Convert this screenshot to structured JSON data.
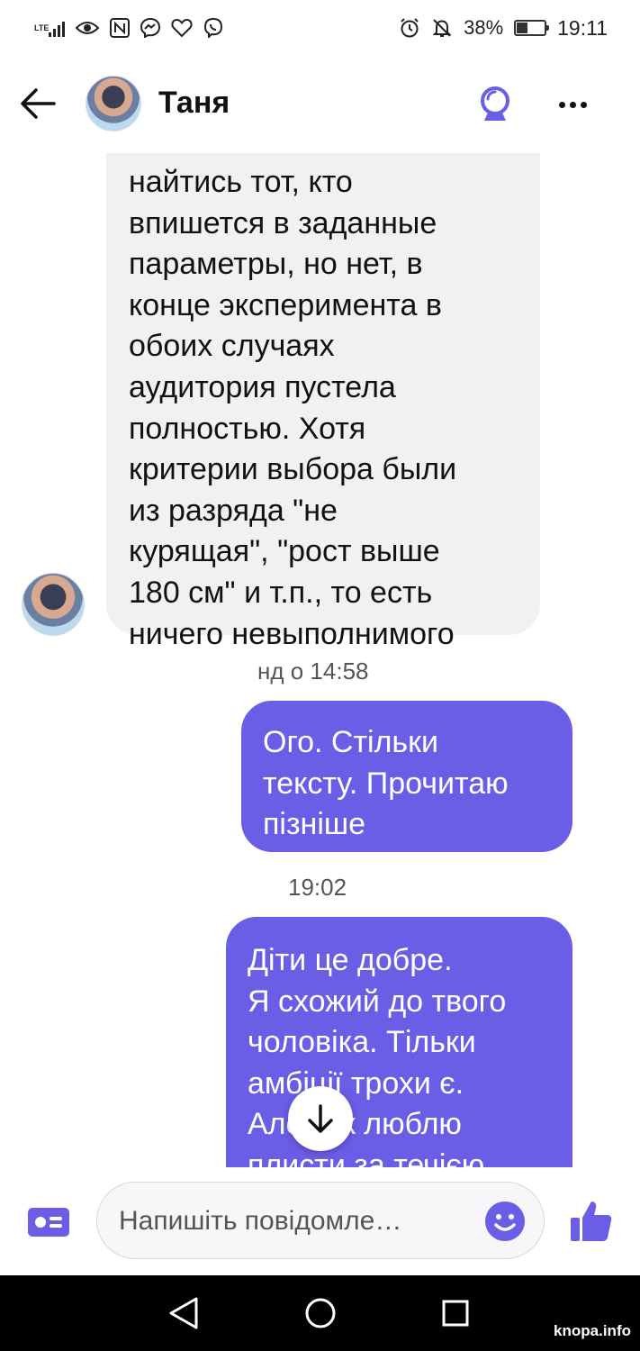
{
  "status_bar": {
    "network_label": "LTE",
    "battery_percent": "38%",
    "time": "19:11",
    "icons": [
      "signal-icon",
      "eye-icon",
      "nfc-icon",
      "messenger-icon",
      "heart-icon",
      "viber-icon",
      "alarm-icon",
      "mute-icon",
      "battery-icon"
    ]
  },
  "header": {
    "contact_name": "Таня",
    "accent_color": "#6a5de6"
  },
  "messages": {
    "incoming_text": "найтись тот, кто\nвпишется в заданные\nпараметры, но нет, в\nконце эксперимента в\nобоих случаях\nаудитория пустела\nполностью. Хотя\nкритерии выбора были\nиз разряда \"не\nкурящая\", \"рост выше\n180 см\" и т.п., то есть\nничего невыполнимого",
    "timestamp_1": "нд о 14:58",
    "outgoing_1": "Ого. Стільки\nтексту. Прочитаю\nпізніше",
    "timestamp_2": "19:02",
    "outgoing_2": "Діти це добре.\nЯ схожий до твого\nчоловіка. Тільки\nамбіції трохи є.\nАле так люблю\nплисти за течією"
  },
  "composer": {
    "placeholder": "Напишіть повідомле…"
  },
  "watermark": "knopa.info"
}
